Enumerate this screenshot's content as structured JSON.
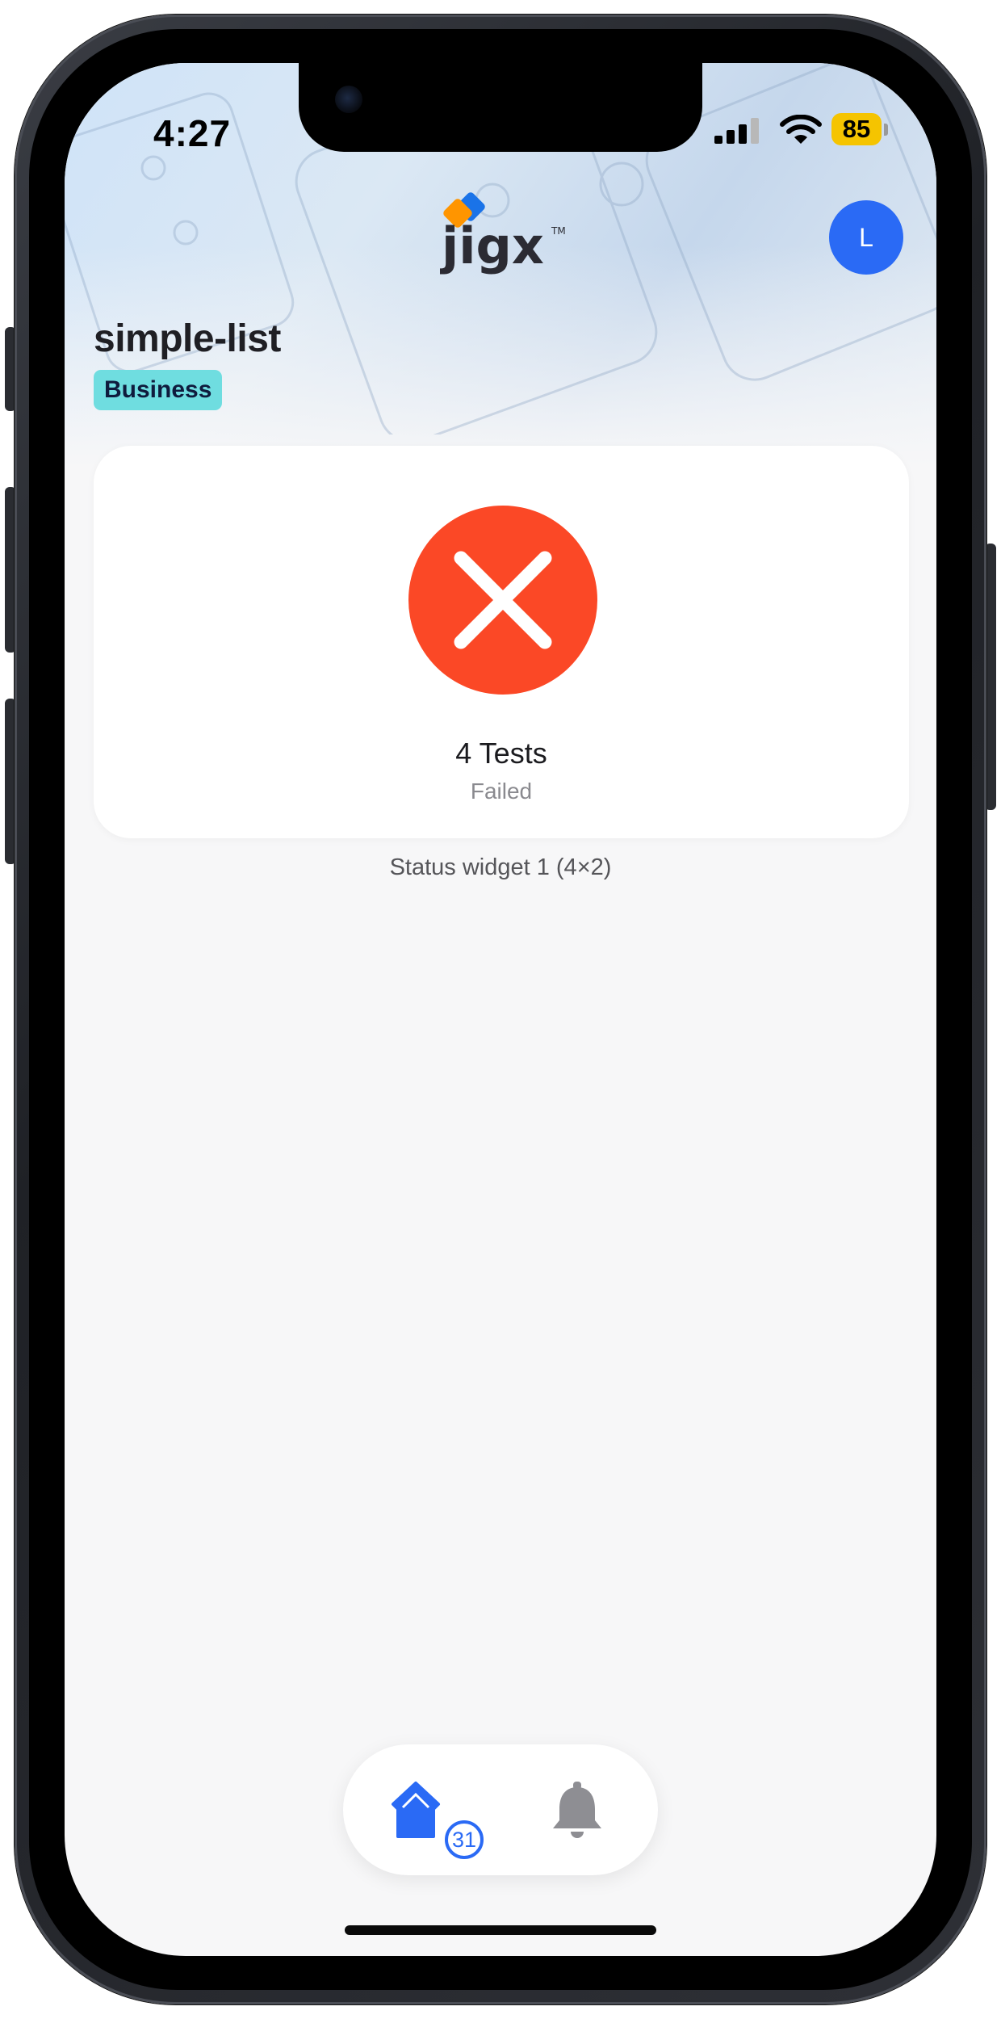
{
  "status_bar": {
    "time": "4:27",
    "battery_level": "85",
    "battery_color": "#f5c400"
  },
  "header": {
    "logo_text": "jigx",
    "avatar_initial": "L",
    "avatar_color": "#2a6af5",
    "page_title": "simple-list",
    "tag_label": "Business",
    "tag_color": "#6fdde0"
  },
  "status_widget": {
    "icon": "close-icon",
    "status_color": "#fb4826",
    "title": "4 Tests",
    "subtitle": "Failed",
    "caption": "Status widget 1 (4×2)"
  },
  "tab_bar": {
    "tabs": [
      {
        "icon": "home-icon",
        "badge": "31",
        "active": true,
        "color": "#2a6af5"
      },
      {
        "icon": "bell-icon",
        "active": false,
        "color": "#8e8e93"
      }
    ]
  }
}
